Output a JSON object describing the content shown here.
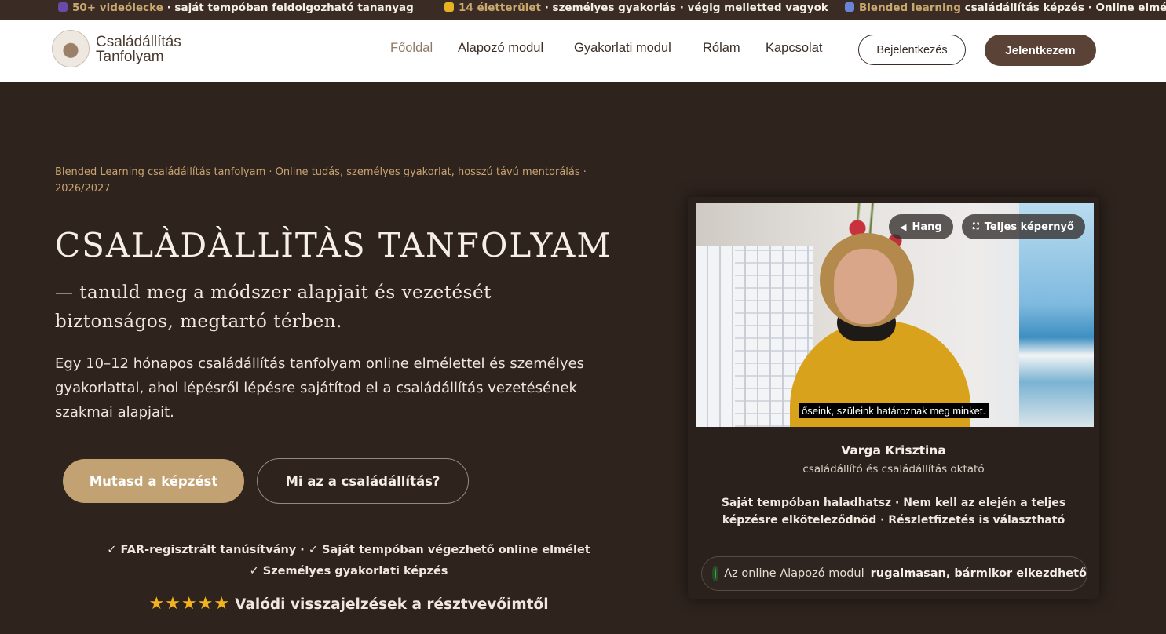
{
  "ticker": [
    {
      "highlight": "50+ videólecke",
      "text": " · saját tempóban feldolgozható tananyag",
      "icon": "graduation-cap-icon",
      "icon_color": "#6a4aa8"
    },
    {
      "highlight": "14 életterület",
      "text": " · személyes gyakorlás · végig melletted vagyok",
      "icon": "heart-hands-icon",
      "icon_color": "#e8b023"
    },
    {
      "highlight": "Blended learning",
      "text": " családállítás képzés · Online elmélet, sze",
      "icon": "calendar-icon",
      "icon_color": "#6a84d8"
    }
  ],
  "header": {
    "logo_line1": "Családállítás",
    "logo_line2": "Tanfolyam",
    "nav": [
      "Főoldal",
      "Alapozó modul",
      "Gyakorlati modul",
      "Rólam",
      "Kapcsolat"
    ],
    "login_label": "Bejelentkezés",
    "join_label": "Jelentkezem"
  },
  "hero": {
    "eyebrow": "Blended Learning családállítás tanfolyam · Online tudás, személyes gyakorlat, hosszú távú mentorálás · 2026/2027",
    "title": "CSALÀDÀLLÌTÀS TANFOLYAM",
    "subtitle": "— tanuld meg a módszer alapjait és vezetését biztonságos, megtartó térben.",
    "lead": "Egy 10–12 hónapos családállítás tanfolyam online elmélettel és személyes gyakorlattal, ahol lépésről lépésre sajátítod el a családállítás vezetésének szakmai alapjait.",
    "cta_primary": "Mutasd a képzést",
    "cta_secondary": "Mi az a családállítás?",
    "checks_line1": "✓ FAR-regisztrált tanúsítvány  ·  ✓ Saját tempóban végezhető online elmélet",
    "checks_line2": "✓ Személyes gyakorlati képzés",
    "stars": "★★★★★",
    "stars_text": "Valódi visszajelzések a résztvevőimtől"
  },
  "video": {
    "sound_label": "Hang",
    "fullscreen_label": "Teljes képernyő",
    "caption": "őseink, szüleink határoznak meg minket.",
    "name": "Varga Krisztina",
    "role": "családállító és családállítás oktató",
    "benefits": "Saját tempóban haladhatsz · Nem kell az elején a teljes képzésre elköteleződnöd · Részletfizetés is választható",
    "status_text": "Az online Alapozó modul",
    "status_strong": "rugalmasan, bármikor elkezdhető"
  },
  "colors": {
    "background": "#2e231d",
    "accent_gold": "#c2a272",
    "button_brown": "#5a4236",
    "status_green": "#27b043"
  }
}
